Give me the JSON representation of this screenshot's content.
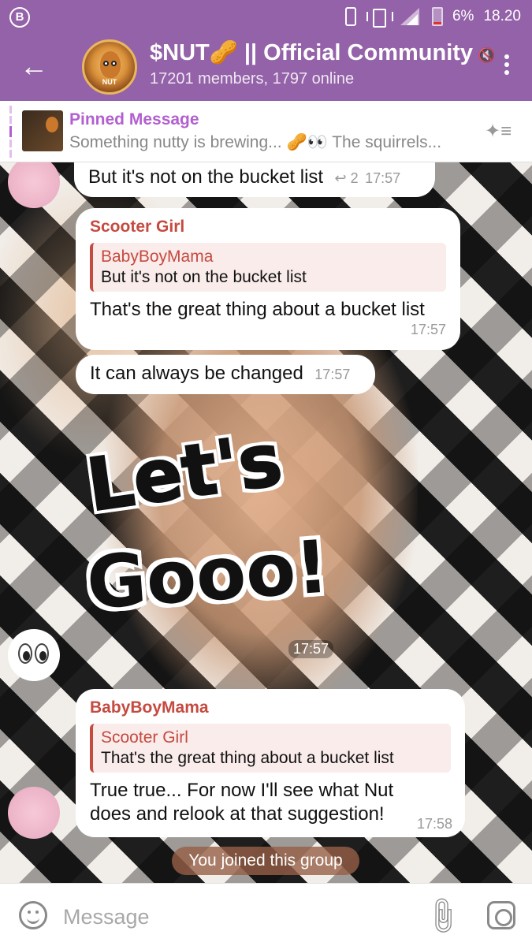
{
  "status_bar": {
    "left_badge": "B",
    "battery": "6%",
    "time": "18.20"
  },
  "header": {
    "back_icon": "arrow-left-icon",
    "avatar_label": "NUT",
    "title": "$NUT🥜 || Official Community",
    "mute_glyph": "🔇",
    "subtitle": "17201 members, 1797 online"
  },
  "pinned": {
    "title": "Pinned Message",
    "text": "Something nutty is brewing... 🥜👀 The squirrels..."
  },
  "messages": [
    {
      "text": "But it's not on the bucket list",
      "reply_count": "↩ 2",
      "time": "17:57"
    },
    {
      "sender": "Scooter Girl",
      "quote_name": "BabyBoyMama",
      "quote_text": "But it's not on the bucket list",
      "text": "That's the great thing about a bucket list",
      "time": "17:57"
    },
    {
      "text": "It can always be changed",
      "time": "17:57"
    },
    {
      "sticker_line1": "Let's",
      "sticker_line2": "Gooo!",
      "time": "17:57"
    },
    {
      "sender": "BabyBoyMama",
      "quote_name": "Scooter Girl",
      "quote_text": "That's the great thing about a bucket list",
      "text": "True true... For now I'll see what Nut does and relook at that suggestion!",
      "time": "17:58"
    }
  ],
  "service_message": "You joined this group",
  "input": {
    "placeholder": "Message"
  },
  "colors": {
    "header": "#9462a8",
    "accent": "#b35fd0",
    "sender": "#c54a3f"
  }
}
